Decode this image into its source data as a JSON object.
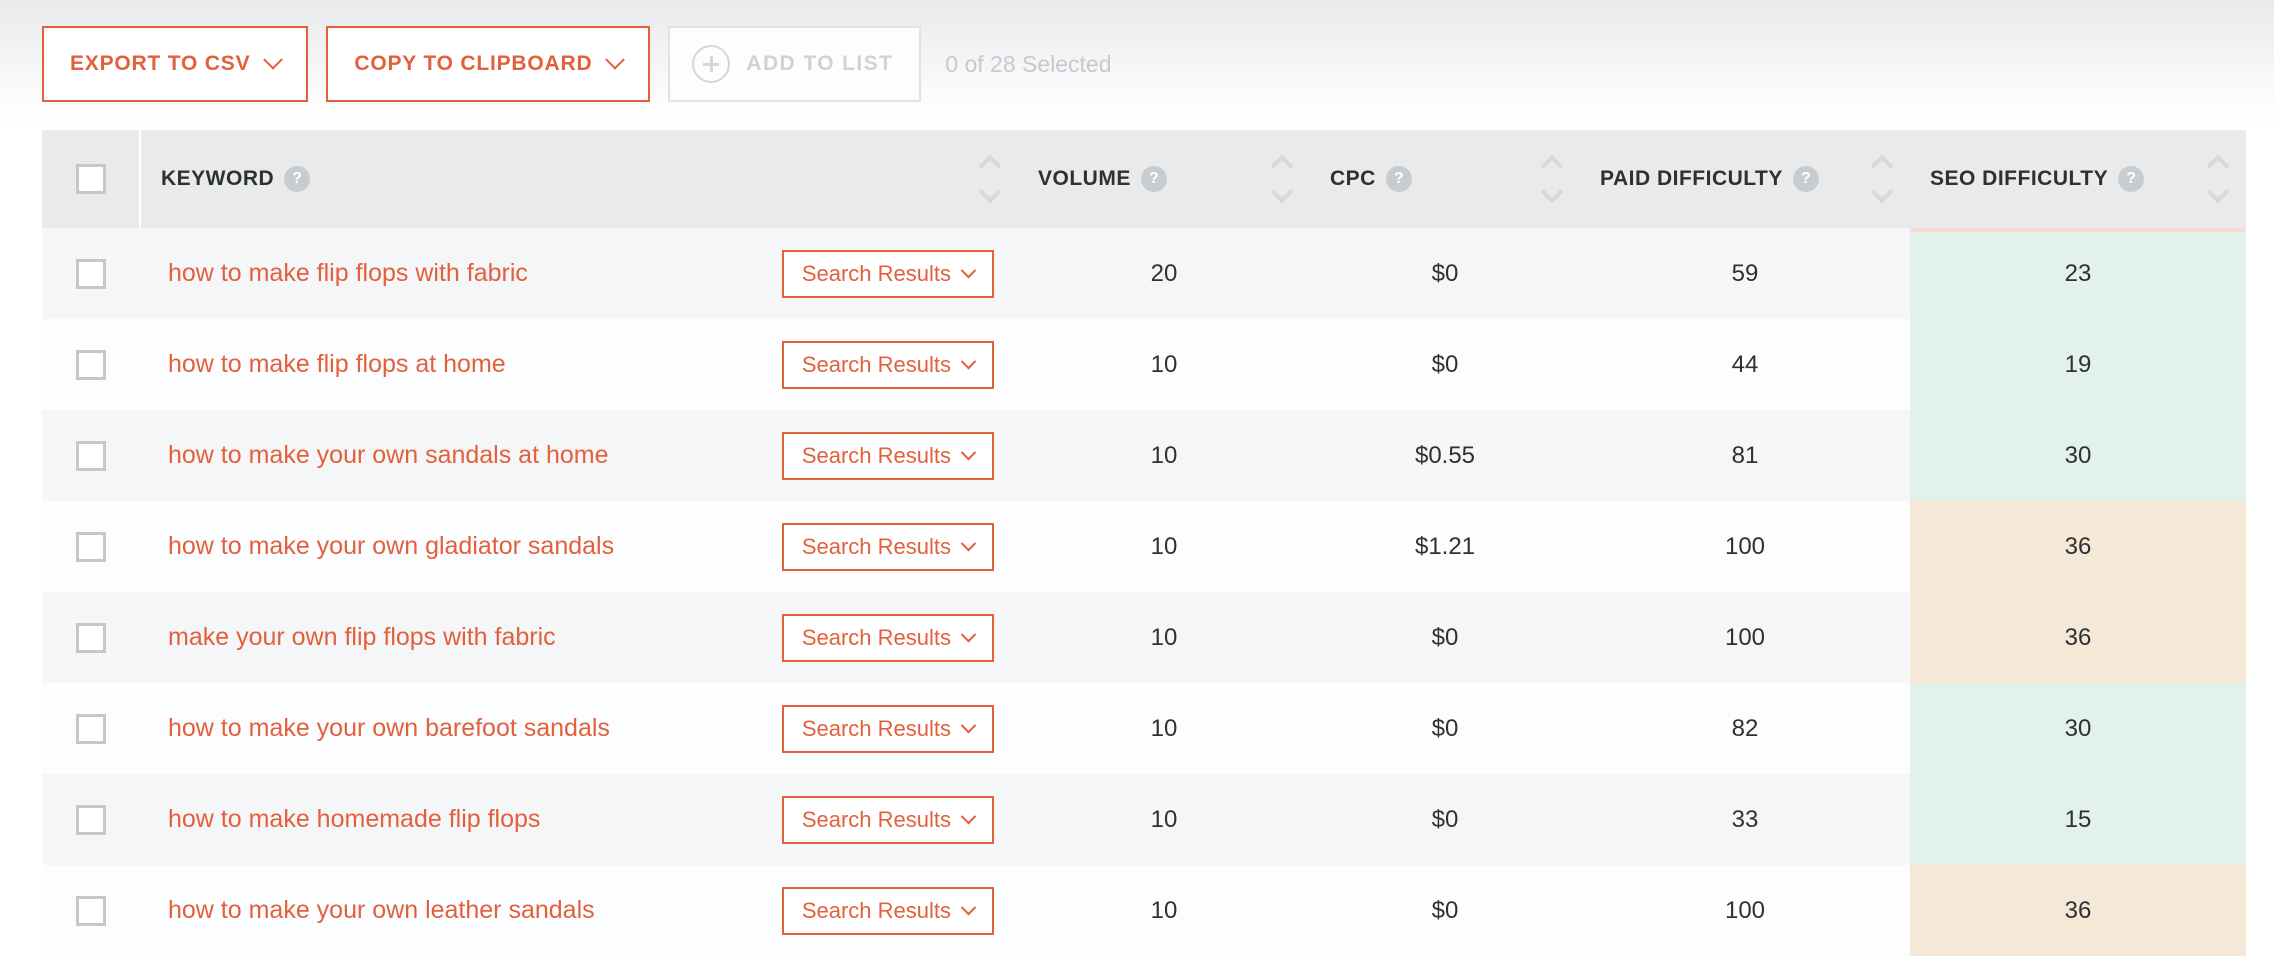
{
  "toolbar": {
    "export_label": "EXPORT TO CSV",
    "copy_label": "COPY TO CLIPBOARD",
    "add_to_list_label": "ADD TO LIST",
    "selected_text": "0 of 28 Selected"
  },
  "table": {
    "columns": [
      {
        "key": "keyword",
        "label": "KEYWORD",
        "help": "?"
      },
      {
        "key": "volume",
        "label": "VOLUME",
        "help": "?"
      },
      {
        "key": "cpc",
        "label": "CPC",
        "help": "?"
      },
      {
        "key": "paid_difficulty",
        "label": "PAID DIFFICULTY",
        "help": "?"
      },
      {
        "key": "seo_difficulty",
        "label": "SEO DIFFICULTY",
        "help": "?"
      }
    ],
    "search_results_label": "Search Results",
    "rows": [
      {
        "keyword": "how to make flip flops with fabric",
        "volume": "20",
        "cpc": "$0",
        "paid": "59",
        "seo": "23",
        "seo_band": "green"
      },
      {
        "keyword": "how to make flip flops at home",
        "volume": "10",
        "cpc": "$0",
        "paid": "44",
        "seo": "19",
        "seo_band": "green"
      },
      {
        "keyword": "how to make your own sandals at home",
        "volume": "10",
        "cpc": "$0.55",
        "paid": "81",
        "seo": "30",
        "seo_band": "green"
      },
      {
        "keyword": "how to make your own gladiator sandals",
        "volume": "10",
        "cpc": "$1.21",
        "paid": "100",
        "seo": "36",
        "seo_band": "tan"
      },
      {
        "keyword": "make your own flip flops with fabric",
        "volume": "10",
        "cpc": "$0",
        "paid": "100",
        "seo": "36",
        "seo_band": "tan"
      },
      {
        "keyword": "how to make your own barefoot sandals",
        "volume": "10",
        "cpc": "$0",
        "paid": "82",
        "seo": "30",
        "seo_band": "green"
      },
      {
        "keyword": "how to make homemade flip flops",
        "volume": "10",
        "cpc": "$0",
        "paid": "33",
        "seo": "15",
        "seo_band": "green"
      },
      {
        "keyword": "how to make your own leather sandals",
        "volume": "10",
        "cpc": "$0",
        "paid": "100",
        "seo": "36",
        "seo_band": "tan"
      }
    ]
  },
  "colors": {
    "accent": "#e2603c",
    "header_bg": "#e8eaeb",
    "seo_green": "#e2f1ea",
    "seo_tan": "#f5e8d6",
    "muted": "#c6c9cd"
  },
  "icons": {
    "chevron_down": "chevron-down-icon",
    "plus": "plus-icon",
    "sort": "sort-icon",
    "help": "help-icon"
  }
}
